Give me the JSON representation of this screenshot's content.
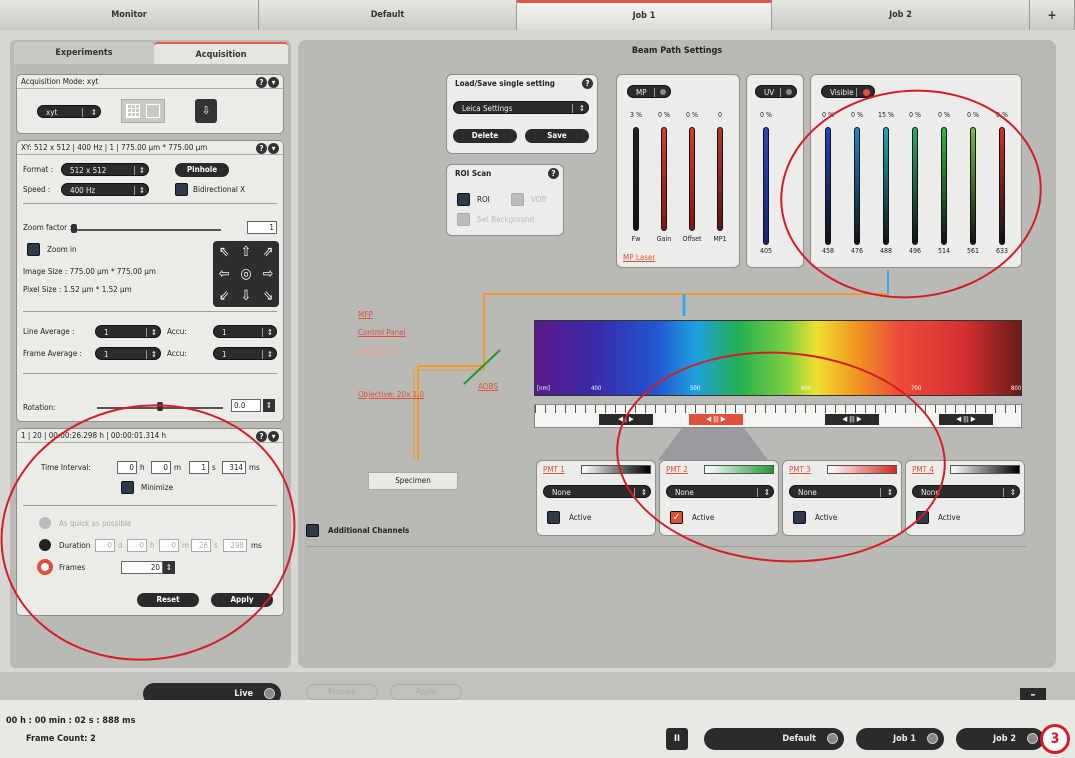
{
  "tabs": {
    "monitor": "Monitor",
    "default": "Default",
    "job1": "Job 1",
    "job2": "Job 2",
    "plus": "+"
  },
  "left": {
    "tab_experiments": "Experiments",
    "tab_acquisition": "Acquisition",
    "acq_mode_title": "Acquisition Mode: xyt",
    "acq_mode_value": "xyt",
    "xy_title": "XY: 512 x 512 | 400 Hz | 1 | 775.00 µm * 775.00 µm",
    "format_label": "Format :",
    "format_value": "512 x 512",
    "pinhole": "Pinhole",
    "speed_label": "Speed :",
    "speed_value": "400 Hz",
    "bidirectional": "Bidirectional X",
    "zoom_factor_label": "Zoom factor :",
    "zoom_factor_value": "1",
    "zoom_in": "Zoom in",
    "image_size": "Image Size :  775.00 µm * 775.00 µm",
    "pixel_size": "Pixel Size :   1.52 µm * 1.52 µm",
    "line_average": "Line Average :",
    "line_avg_value": "1",
    "accu1": "Accu:",
    "accu1_value": "1",
    "frame_average": "Frame Average :",
    "frame_avg_value": "1",
    "accu2": "Accu:",
    "accu2_value": "1",
    "rotation": "Rotation:",
    "rotation_value": "0.0",
    "time_title": "1 | 20 | 00:00:26.298 h | 00:00:01.314 h",
    "time_interval": "Time Interval:",
    "ti_h": "0",
    "ti_m": "0",
    "ti_s": "1",
    "ti_ms": "314",
    "u_h": "h",
    "u_m": "m",
    "u_s": "s",
    "u_ms": "ms",
    "minimize": "Minimize",
    "as_fast": "As quick as possible",
    "duration": "Duration",
    "du_d": "0",
    "du_h": "0",
    "du_m": "0",
    "du_s": "26",
    "du_ms": "298",
    "u_d": "d",
    "frames": "Frames",
    "frames_value": "20",
    "reset": "Reset",
    "apply": "Apply"
  },
  "right": {
    "title": "Beam Path Settings",
    "load_save_title": "Load/Save single setting",
    "leica_settings": "Leica Settings",
    "delete": "Delete",
    "save": "Save",
    "roi_scan": "ROI Scan",
    "roi": "ROI",
    "voff": "VOff",
    "set_background": "Set Background",
    "mp_label": "MP",
    "uv_label": "UV",
    "visible_label": "Visible",
    "mp_pcts": [
      "3 %",
      "0 %",
      "0 %",
      "0"
    ],
    "mp_names": [
      "Fw",
      "Gain",
      "Offset",
      "MP1"
    ],
    "mp_laser": "MP Laser",
    "uv_pct": "0 %",
    "uv_wl": "405",
    "vis_pcts": [
      "0 %",
      "0 %",
      "15 %",
      "0 %",
      "0 %",
      "0 %",
      "0 %"
    ],
    "vis_wls": [
      "458",
      "476",
      "488",
      "496",
      "514",
      "561",
      "633"
    ],
    "mfp": "MFP",
    "control_panel": "Control Panel",
    "specimen_link": "Specimen",
    "objective": "Objective: 20x 1.0",
    "aobs": "AOBS",
    "specimen": "Specimen",
    "spec_ticks": [
      "[nm]",
      "400",
      "500",
      "600",
      "700",
      "800"
    ],
    "pmts": [
      {
        "name": "PMT 1",
        "value": "None",
        "active": "Active"
      },
      {
        "name": "PMT 2",
        "value": "None",
        "active": "Active"
      },
      {
        "name": "PMT 3",
        "value": "None",
        "active": "Active"
      },
      {
        "name": "PMT 4",
        "value": "None",
        "active": "Active"
      }
    ],
    "additional": "Additional Channels"
  },
  "bottom": {
    "live": "Live",
    "prepare": "Prepare",
    "apply": "Apply",
    "time": "00 h : 00 min : 02 s : 888 ms",
    "frame_count": "Frame Count: 2",
    "pause": "II",
    "default": "Default",
    "job1": "Job 1",
    "job2": "Job 2",
    "badge": "3",
    "minus": "–"
  },
  "colors": {
    "accent": "#e05a4a",
    "annotation": "#d41e25"
  }
}
